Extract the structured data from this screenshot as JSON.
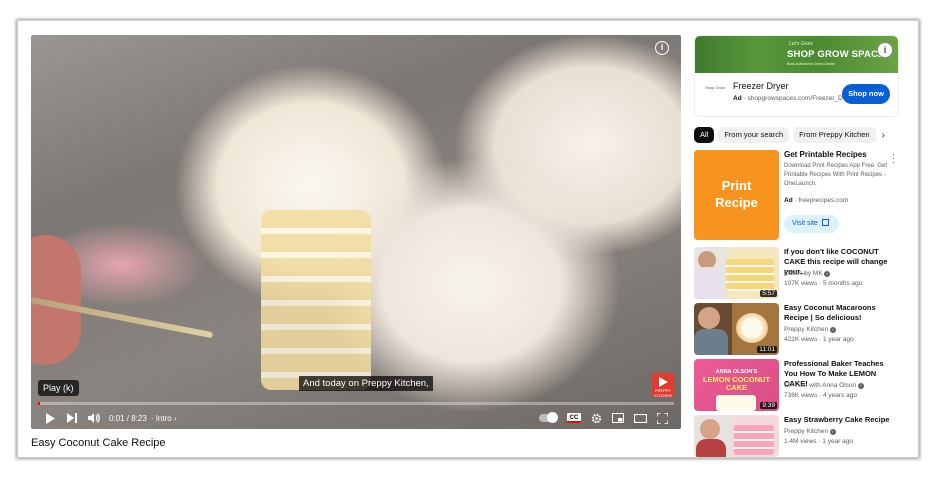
{
  "player": {
    "tooltip": "Play (k)",
    "caption": "And today on Preppy Kitchen,",
    "time": "0:01 / 8:23",
    "chapter": "Intro",
    "progress_fraction": 0.003,
    "watermark": "PREPPY KITCHEN"
  },
  "video": {
    "title": "Easy Coconut Cake Recipe"
  },
  "ad": {
    "banner_subtitle": "Let's Grow",
    "banner_title": "SHOP GROW SPACES",
    "banner_small": "Book Authorized Online Dealer",
    "logo_text": "Shop Grow",
    "name": "Freezer Dryer",
    "ad_label": "Ad",
    "url": "shopgrowspaces.com/Freezer_D",
    "button": "Shop now"
  },
  "chips": [
    {
      "label": "All",
      "active": true
    },
    {
      "label": "From your search",
      "active": false
    },
    {
      "label": "From Preppy Kitchen",
      "active": false
    }
  ],
  "promo": {
    "thumb_text_1": "Print",
    "thumb_text_2": "Recipe",
    "title": "Get Printable Recipes",
    "description": "Download Print Recipes App Free. Get Printable Recipes With Print Recipes - OneLaunch.",
    "ad_label": "Ad",
    "url": "freeprecipes.com",
    "button": "Visit site"
  },
  "recommendations": [
    {
      "title": "If you don't like COCONUT CAKE this recipe will change your...",
      "channel": "Cakes by MK",
      "meta": "107K views · 5 months ago",
      "duration": "5:57"
    },
    {
      "title": "Easy Coconut Macaroons Recipe | So delicious!",
      "channel": "Preppy Kitchen",
      "meta": "421K views · 1 year ago",
      "duration": "11:01"
    },
    {
      "title": "Professional Baker Teaches You How To Make LEMON CAKE!",
      "channel": "Oh Yum with Anna Olson",
      "meta": "738K views · 4 years ago",
      "duration": "9:39",
      "thumb_text_1": "ANNA OLSON'S",
      "thumb_text_2": "LEMON COCONUT",
      "thumb_text_3": "CAKE"
    },
    {
      "title": "Easy Strawberry Cake Recipe",
      "channel": "Preppy Kitchen",
      "meta": "1.4M views · 1 year ago",
      "duration": ""
    }
  ],
  "icons": {
    "player_info": "info-icon",
    "play": "play-icon",
    "next": "next-icon",
    "volume": "volume-icon",
    "autoplay": "autoplay-toggle",
    "subtitles": "cc-icon",
    "settings": "gear-icon",
    "miniplayer": "miniplayer-icon",
    "theater": "theater-icon",
    "fullscreen": "fullscreen-icon"
  }
}
